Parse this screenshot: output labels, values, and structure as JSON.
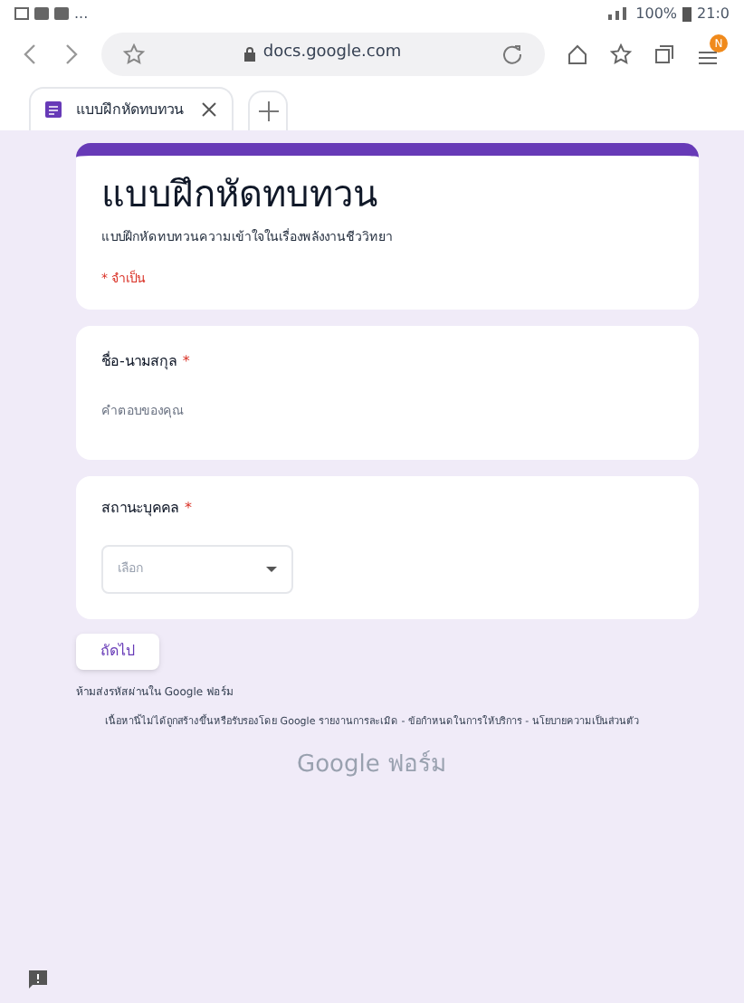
{
  "status_bar": {
    "notifications": "...",
    "battery": "100%",
    "time": "21:0"
  },
  "browser": {
    "url": "docs.google.com",
    "menu_badge": "N",
    "tab": {
      "title": "แบบฝึกหัดทบทวน",
      "selected": true
    }
  },
  "form": {
    "title": "แบบฝึกหัดทบทวน",
    "description": "แบบฝึกหัดทบทวนความเข้าใจในเรื่องพลังงานชีววิทยา",
    "required_note": "* จำเป็น",
    "questions": [
      {
        "kind": "text",
        "label": "ชื่อ-นามสกุล",
        "required_mark": "*",
        "placeholder": "คำตอบของคุณ"
      },
      {
        "kind": "dropdown",
        "label": "สถานะบุคคล",
        "required_mark": "*",
        "placeholder": "เลือก"
      }
    ],
    "next_button": "ถัดไป",
    "password_warning": "ห้ามส่งรหัสผ่านใน Google ฟอร์ม",
    "disclaimer": "เนื้อหานี้ไม่ได้ถูกสร้างขึ้นหรือรับรองโดย Google รายงานการละเมิด - ข้อกำหนดในการให้บริการ - นโยบายความเป็นส่วนตัว",
    "logo": "Google ฟอร์ม"
  }
}
